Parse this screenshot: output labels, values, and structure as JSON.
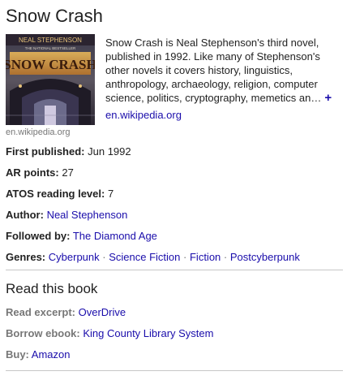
{
  "title": "Snow Crash",
  "cover": {
    "author_text": "NEAL STEPHENSON",
    "tagline_text": "THE NATIONAL BESTSELLER",
    "title_text": "SNOW CRASH",
    "caption": "en.wikipedia.org"
  },
  "description": {
    "text": "Snow Crash is Neal Stephenson's third novel, published in 1992. Like many of Stephenson's other novels it covers history, linguistics, anthropology, archaeology, religion, computer science, politics, cryptography, memetics an…",
    "more_symbol": "+",
    "source": "en.wikipedia.org"
  },
  "facts": {
    "first_published": {
      "label": "First published:",
      "value": "Jun 1992"
    },
    "ar_points": {
      "label": "AR points:",
      "value": "27"
    },
    "atos": {
      "label": "ATOS reading level:",
      "value": "7"
    },
    "author": {
      "label": "Author:",
      "value": "Neal Stephenson"
    },
    "followed_by": {
      "label": "Followed by:",
      "value": "The Diamond Age"
    },
    "genres": {
      "label": "Genres:",
      "items": [
        "Cyberpunk",
        "Science Fiction",
        "Fiction",
        "Postcyberpunk"
      ],
      "separator": "·"
    }
  },
  "read_section": {
    "heading": "Read this book",
    "read_excerpt": {
      "label": "Read excerpt:",
      "value": "OverDrive"
    },
    "borrow_ebook": {
      "label": "Borrow ebook:",
      "value": "King County Library System"
    },
    "buy": {
      "label": "Buy:",
      "value": "Amazon"
    }
  },
  "colors": {
    "link": "#1a0dab",
    "label_muted": "#777777",
    "text": "#222222",
    "divider": "#c7c7c7"
  }
}
